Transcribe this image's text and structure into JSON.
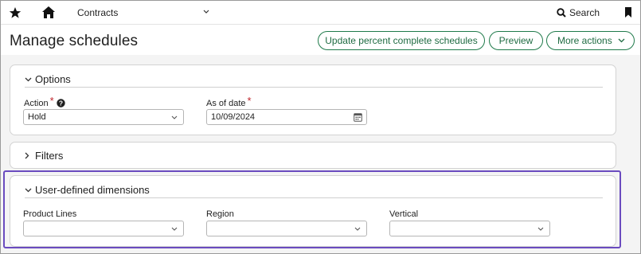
{
  "topbar": {
    "app_name": "Contracts",
    "search_label": "Search"
  },
  "header": {
    "title": "Manage schedules",
    "buttons": {
      "update": "Update percent complete schedules",
      "preview": "Preview",
      "more": "More actions"
    }
  },
  "sections": {
    "options": {
      "title": "Options",
      "action_label": "Action",
      "action_value": "Hold",
      "as_of_date_label": "As of date",
      "as_of_date_value": "10/09/2024",
      "required_mark": "*"
    },
    "filters": {
      "title": "Filters"
    },
    "udd": {
      "title": "User-defined dimensions",
      "fields": [
        {
          "label": "Product Lines",
          "value": ""
        },
        {
          "label": "Region",
          "value": ""
        },
        {
          "label": "Vertical",
          "value": ""
        }
      ]
    }
  },
  "colors": {
    "accent_green": "#1f7a4a",
    "highlight_purple": "#6a4bbf",
    "required_red": "#c0262d"
  }
}
